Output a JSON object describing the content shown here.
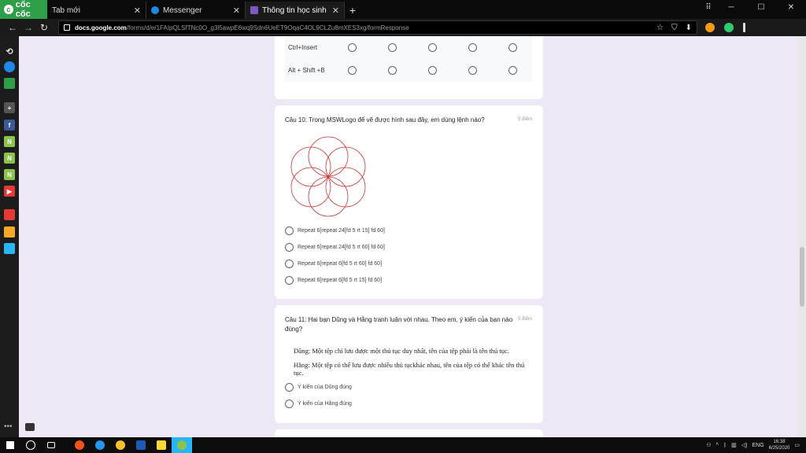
{
  "browser": {
    "brand": "cốc cốc",
    "tabs": [
      {
        "label": "Tab mới",
        "active": false
      },
      {
        "label": "Messenger",
        "active": false
      },
      {
        "label": "Thông tin học sinh",
        "active": true
      }
    ],
    "url_host": "docs.google.com",
    "url_path": "/forms/d/e/1FAIpQLSfTNc0O_g3l5awpE6wq9Sdn6UeET9OqaC4OL9CLZu8mXES3xg/formResponse"
  },
  "form": {
    "matrix_rows": [
      {
        "label": "Ctrl+Insert"
      },
      {
        "label": "Alt + Shift +B"
      }
    ],
    "q10": {
      "title": "Câu 10: Trong MSWLogo để vẽ được hình sau đây, em dùng lệnh nào?",
      "points": "5 điểm",
      "options": [
        "Repeat 6[repeat 24[fd 5 rt 15] fd 60]",
        "Repeat 6[repeat 24[fd 5 rt 60] fd 60]",
        "Repeat 6[repeat 6[fd 5 rt 60] fd 60]",
        "Repeat 6[repeat 6[fd 5 rt 15] fd 60]"
      ]
    },
    "q11": {
      "title": "Câu 11: Hai bạn Dũng và Hằng tranh luận với nhau. Theo em, ý kiến của bạn nào đúng?",
      "points": "5 điểm",
      "quote1": "Dũng: Một tệp chỉ lưu được một thủ tục duy nhất, tên của tệp phải là tên thủ tục.",
      "quote2": "Hằng: Một tệp có thể lưu được nhiều thủ tụckhác nhau, tên của tệp có thể khác tên thủ tục.",
      "options": [
        "Ý kiến của Dũng đúng",
        "Ý kiến của Hằng đúng"
      ]
    }
  },
  "taskbar": {
    "lang": "ENG",
    "time": "16:38",
    "date": "6/25/2020"
  },
  "colors": {
    "page_bg": "#ede7f6",
    "flower_stroke": "#d32f2f",
    "brand_green": "#2e9e48"
  }
}
